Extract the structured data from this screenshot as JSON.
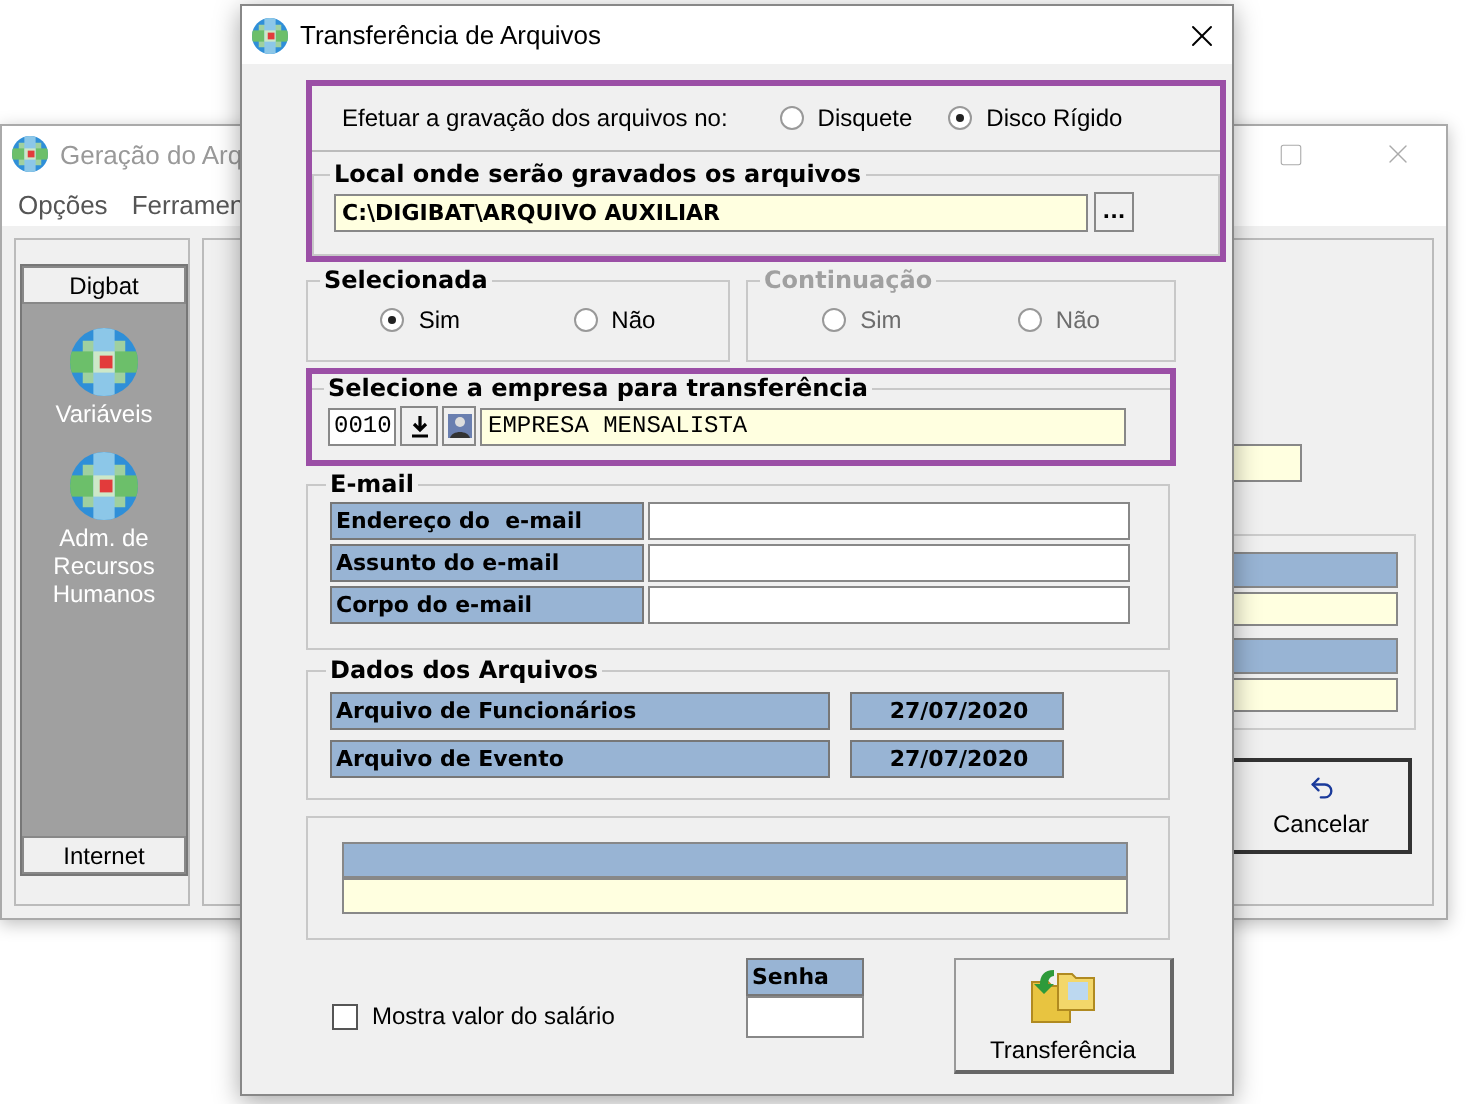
{
  "background_window": {
    "title": "Geração do Arq",
    "menu": [
      "Opções",
      "Ferramen"
    ],
    "sidebar": {
      "header": "Digbat",
      "items": [
        {
          "label": "Variáveis"
        },
        {
          "label": "Adm. de Recursos Humanos"
        }
      ],
      "footer": "Internet"
    },
    "cancel_button": "Cancelar"
  },
  "dialog": {
    "title": "Transferência de Arquivos",
    "destination": {
      "highlighted": true,
      "prompt": "Efetuar a gravação dos arquivos no:",
      "options": [
        {
          "label": "Disquete",
          "selected": false
        },
        {
          "label": "Disco Rígido",
          "selected": true
        }
      ],
      "location_title": "Local onde serão gravados os arquivos",
      "location_value": "C:\\DIGIBAT\\ARQUIVO AUXILIAR",
      "browse_button": "..."
    },
    "choice_groups": [
      {
        "title": "Selecionada",
        "disabled": false,
        "options": [
          {
            "label": "Sim",
            "selected": true
          },
          {
            "label": "Não",
            "selected": false
          }
        ]
      },
      {
        "title": "Continuação",
        "disabled": true,
        "options": [
          {
            "label": "Sim",
            "selected": false
          },
          {
            "label": "Não",
            "selected": false
          }
        ]
      }
    ],
    "company": {
      "highlighted": true,
      "title": "Selecione a empresa para transferência",
      "code": "0010",
      "name": "EMPRESA MENSALISTA"
    },
    "email": {
      "title": "E-mail",
      "rows": [
        {
          "label": "Endereço do  e-mail"
        },
        {
          "label": "Assunto do e-mail"
        },
        {
          "label": "Corpo do e-mail"
        }
      ]
    },
    "files": {
      "title": "Dados dos Arquivos",
      "rows": [
        {
          "label": "Arquivo de Funcionários",
          "date": "27/07/2020"
        },
        {
          "label": "Arquivo de Evento",
          "date": "27/07/2020"
        }
      ]
    },
    "show_salary": {
      "label": "Mostra valor do salário",
      "checked": false
    },
    "password": {
      "label": "Senha"
    },
    "transfer_button": "Transferência"
  }
}
